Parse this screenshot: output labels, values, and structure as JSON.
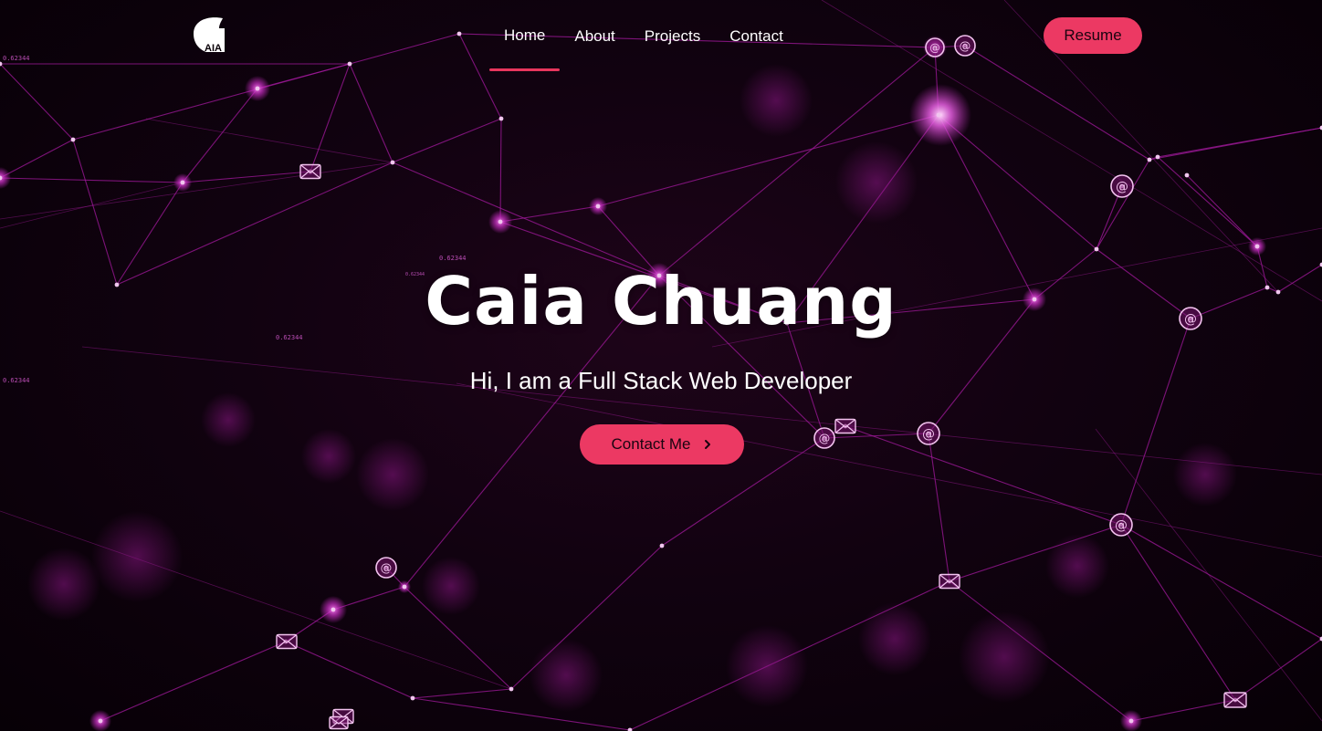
{
  "brand": {
    "logo_text": "AIA"
  },
  "nav": {
    "items": [
      {
        "label": "Home",
        "active": true
      },
      {
        "label": "About",
        "active": false
      },
      {
        "label": "Projects",
        "active": false
      },
      {
        "label": "Contact",
        "active": false
      }
    ],
    "resume_label": "Resume"
  },
  "hero": {
    "title": "Caia Chuang",
    "subtitle": "Hi, I am a Full Stack Web Developer",
    "cta_label": "Contact Me",
    "cta_icon": "chevron-right-icon"
  },
  "background": {
    "floating_numbers": [
      "0.62344",
      "0.62344",
      "0.62344",
      "0.62344",
      "0.62344"
    ],
    "icons": [
      "at-sign-icon",
      "envelope-icon"
    ]
  },
  "colors": {
    "accent": "#ec3963",
    "node": "#c52cc0",
    "line": "#a21a9c",
    "background": "#0a0108"
  }
}
